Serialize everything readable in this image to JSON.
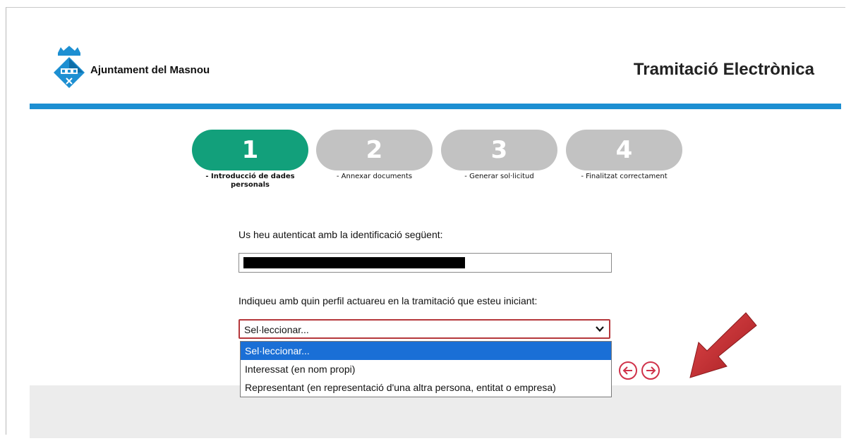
{
  "header": {
    "brand_name": "Ajuntament del Masnou",
    "page_title": "Tramitació Electrònica",
    "accent_color": "#1d8fd2"
  },
  "steps": [
    {
      "number": "1",
      "label": "- Introducció de dades personals",
      "active": true
    },
    {
      "number": "2",
      "label": "- Annexar documents",
      "active": false
    },
    {
      "number": "3",
      "label": "- Generar sol·licitud",
      "active": false
    },
    {
      "number": "4",
      "label": "- Finalitzat correctament",
      "active": false
    }
  ],
  "form": {
    "auth_prompt": "Us heu autenticat amb la identificació següent:",
    "profile_prompt": "Indiqueu amb quin perfil actuareu en la tramitació que esteu iniciant:",
    "profile_select": {
      "selected": "Sel·leccionar...",
      "options": [
        "Sel·leccionar...",
        "Interessat (en nom propi)",
        "Representant (en representació d'una altra persona, entitat o empresa)"
      ]
    }
  },
  "colors": {
    "step_active": "#12a07b",
    "step_inactive": "#c2c2c2",
    "select_border": "#b5373b",
    "option_highlight": "#1a6fd6",
    "nav_buttons": "#d0324a",
    "annotation_arrow": "#c8282e"
  },
  "icons": {
    "logo": "masnou-coat-of-arms",
    "prev": "arrow-left-circle-icon",
    "next": "arrow-right-circle-icon",
    "select": "chevron-down-icon"
  }
}
